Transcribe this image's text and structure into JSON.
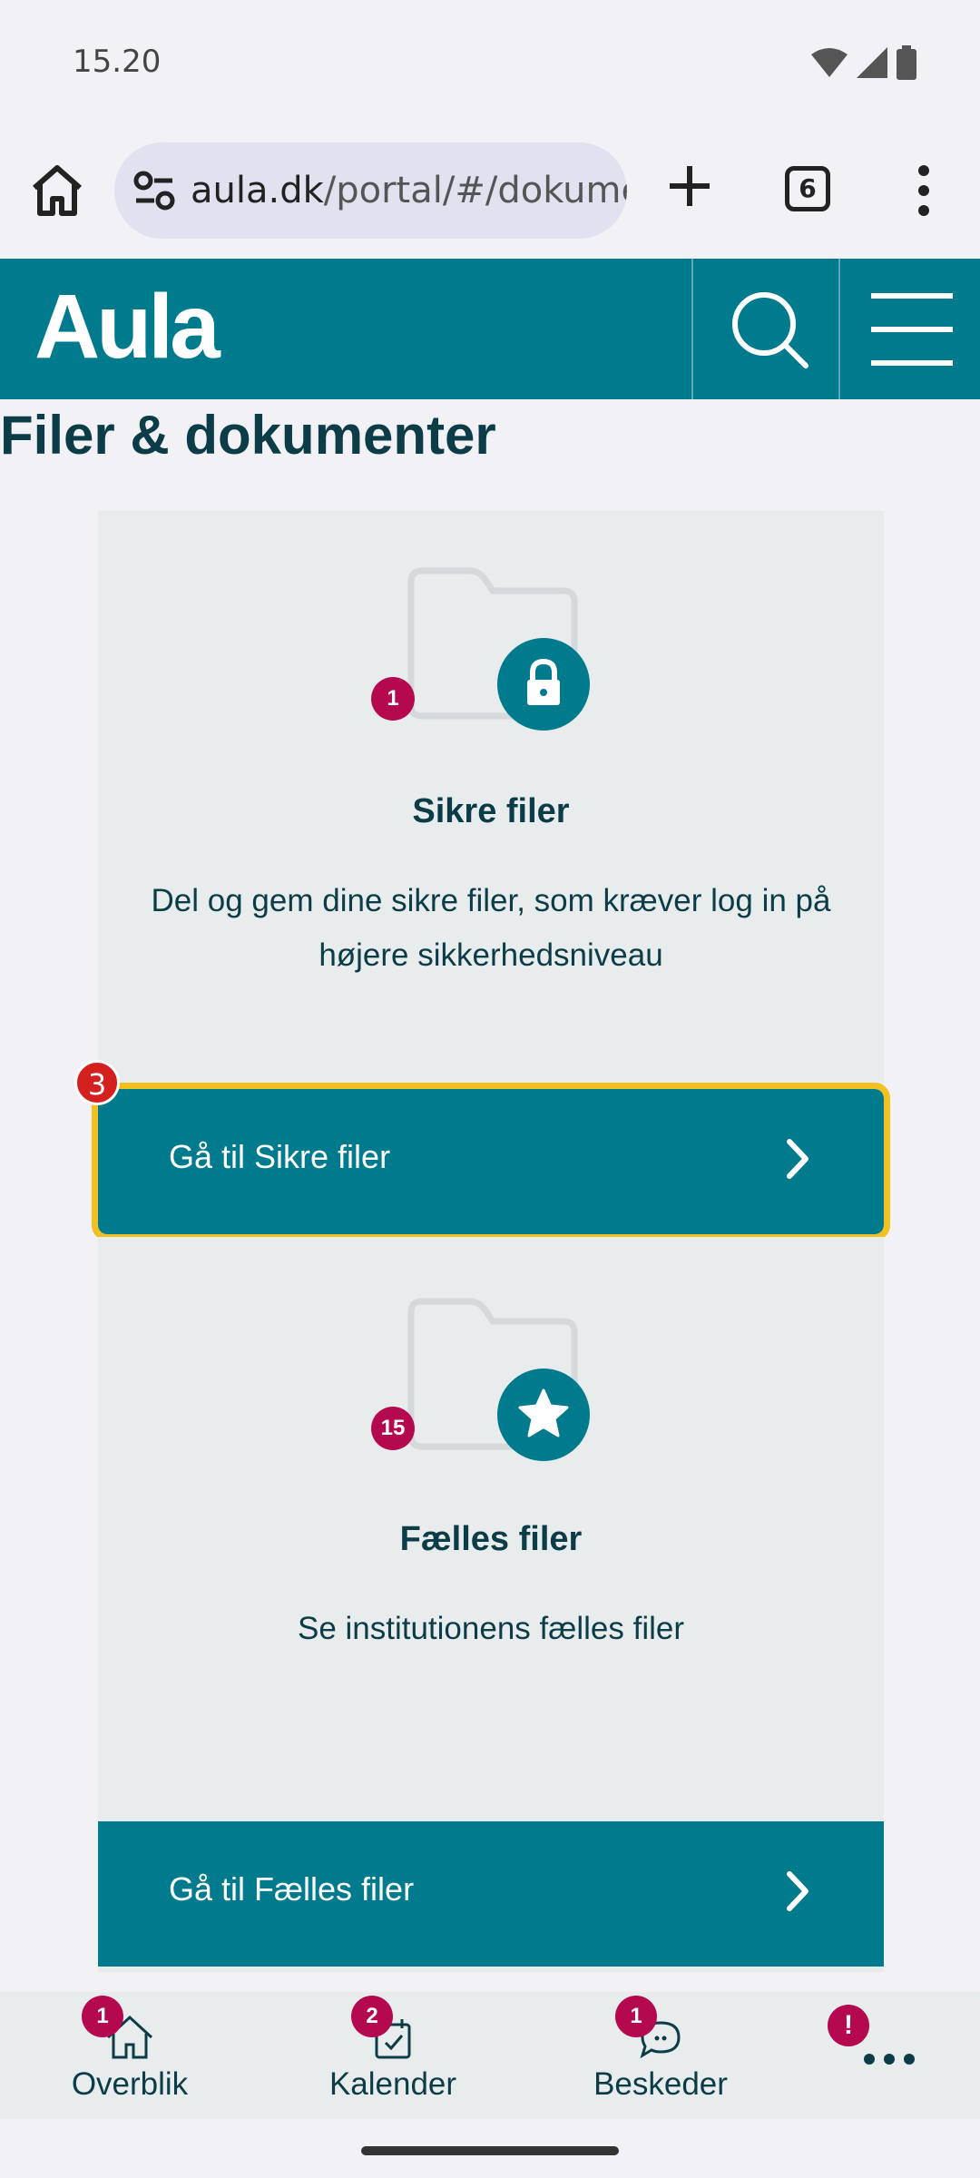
{
  "status": {
    "time": "15.20"
  },
  "browser": {
    "url_host": "aula.dk",
    "url_path": "/portal/#/dokume",
    "tab_count": "6"
  },
  "header": {
    "logo": "Aula"
  },
  "page": {
    "title": "Filer & dokumenter"
  },
  "cards": [
    {
      "badge": "1",
      "title": "Sikre filer",
      "description": "Del og gem dine sikre filer, som kræver log in på højere sikkerhedsniveau",
      "button": "Gå til Sikre filer",
      "icon": "lock-icon"
    },
    {
      "badge": "15",
      "title": "Fælles filer",
      "description": "Se institutionens fælles filer",
      "button": "Gå til Fælles filer",
      "icon": "star-icon"
    }
  ],
  "step_badge": "3",
  "bottom_nav": [
    {
      "label": "Overblik",
      "badge": "1",
      "icon": "home-icon"
    },
    {
      "label": "Kalender",
      "badge": "2",
      "icon": "calendar-icon"
    },
    {
      "label": "Beskeder",
      "badge": "1",
      "icon": "chat-icon"
    },
    {
      "label": "",
      "badge": "!",
      "icon": "more-icon"
    }
  ],
  "colors": {
    "brand": "#007a8d",
    "badge": "#b4094f",
    "focus": "#f3c021"
  }
}
